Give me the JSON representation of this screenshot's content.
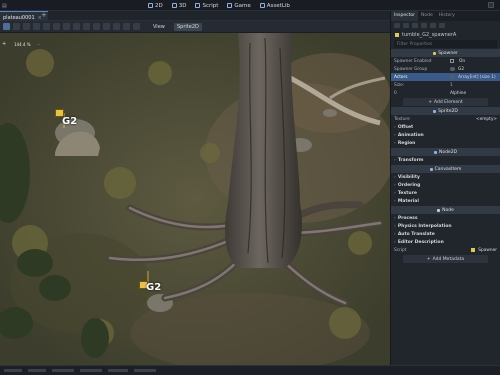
{
  "topbar": {
    "modes": [
      {
        "label": "2D",
        "icon": "2d-icon"
      },
      {
        "label": "3D",
        "icon": "3d-icon"
      },
      {
        "label": "Script",
        "icon": "script-icon"
      },
      {
        "label": "Game",
        "icon": "game-icon"
      },
      {
        "label": "AssetLib",
        "icon": "assetlib-icon"
      }
    ]
  },
  "scene_tab": {
    "label": "plateau0001",
    "close": "×",
    "add": "+"
  },
  "toolbar": {
    "view_label": "View",
    "sprite_label": "Sprite2D"
  },
  "viewport": {
    "zoom": "144.4 %",
    "zoom_in": "+",
    "zoom_out": "-",
    "spawner_a_label": "G2",
    "spawner_b_label": "G2"
  },
  "inspector": {
    "tabs": [
      "Inspector",
      "Node",
      "History"
    ],
    "node_path": "tumble_G2_spawnerA",
    "filter_placeholder": "Filter Properties",
    "spawner_section": "Spawner",
    "spawner_enabled_label": "Spawner Enabled",
    "spawner_enabled_value": "On",
    "spawner_group_label": "Spawner Group",
    "spawner_group_value": "G2",
    "actors_label": "Actors",
    "actors_value": "Array[int] (size 1)",
    "size_label": "Size:",
    "size_value": "1",
    "item_index": "0",
    "item_value": "Alphine",
    "add_element": "Add Element",
    "sprite_section": "Sprite2D",
    "texture_label": "Texture",
    "texture_value": "<empty>",
    "sprite_groups": [
      "Offset",
      "Animation",
      "Region"
    ],
    "node2d_section": "Node2D",
    "node2d_groups": [
      "Transform"
    ],
    "canvasitem_section": "CanvasItem",
    "canvas_groups": [
      "Visibility",
      "Ordering",
      "Texture",
      "Material"
    ],
    "node_section": "Node",
    "node_groups": [
      "Process",
      "Physics Interpolation",
      "Auto Translate",
      "Editor Description"
    ],
    "script_label": "Script",
    "script_value": "Spawner",
    "add_metadata": "Add Metadata"
  },
  "colors": {
    "accent": "#5b86c4",
    "highlight": "#3a5a8a",
    "bg": "#21262d"
  }
}
